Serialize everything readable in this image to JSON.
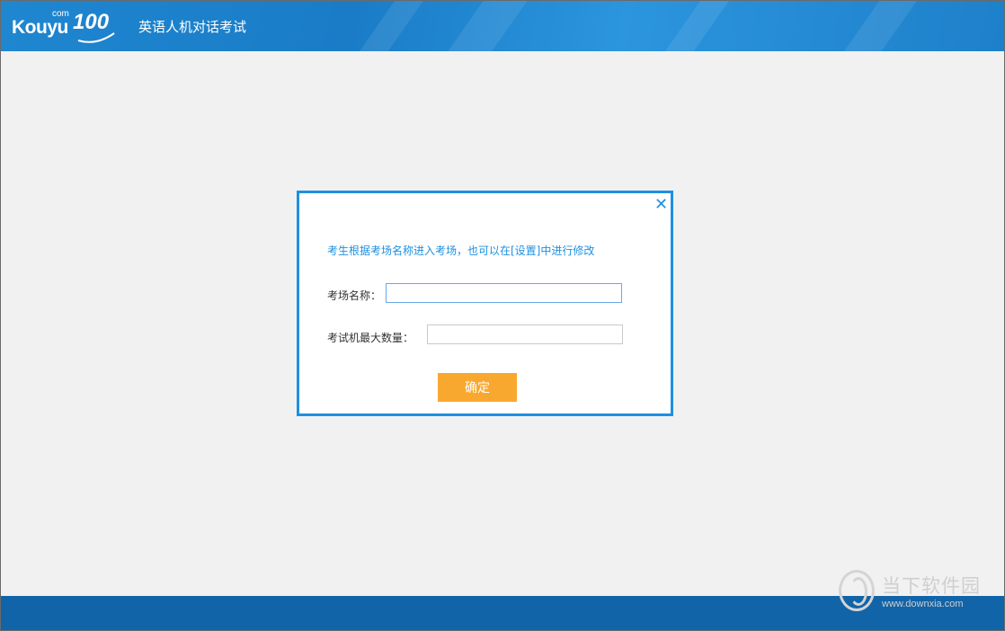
{
  "header": {
    "logo": {
      "main": "Kouyu",
      "com": "com",
      "num": "100"
    },
    "title": "英语人机对话考试"
  },
  "dialog": {
    "close_icon": "close-icon",
    "hint": "考生根据考场名称进入考场，也可以在[设置]中进行修改",
    "fields": {
      "room_name": {
        "label": "考场名称：",
        "value": "",
        "placeholder": ""
      },
      "max_machines": {
        "label": "考试机最大数量：",
        "value": "",
        "placeholder": ""
      }
    },
    "confirm_label": "确定"
  },
  "watermark": {
    "name": "当下软件园",
    "url": "www.downxia.com"
  },
  "colors": {
    "header_blue": "#1f86d0",
    "footer_blue": "#1164a8",
    "accent_blue": "#1e90e0",
    "confirm_orange": "#f9a82f",
    "background": "#f1f1f1"
  }
}
